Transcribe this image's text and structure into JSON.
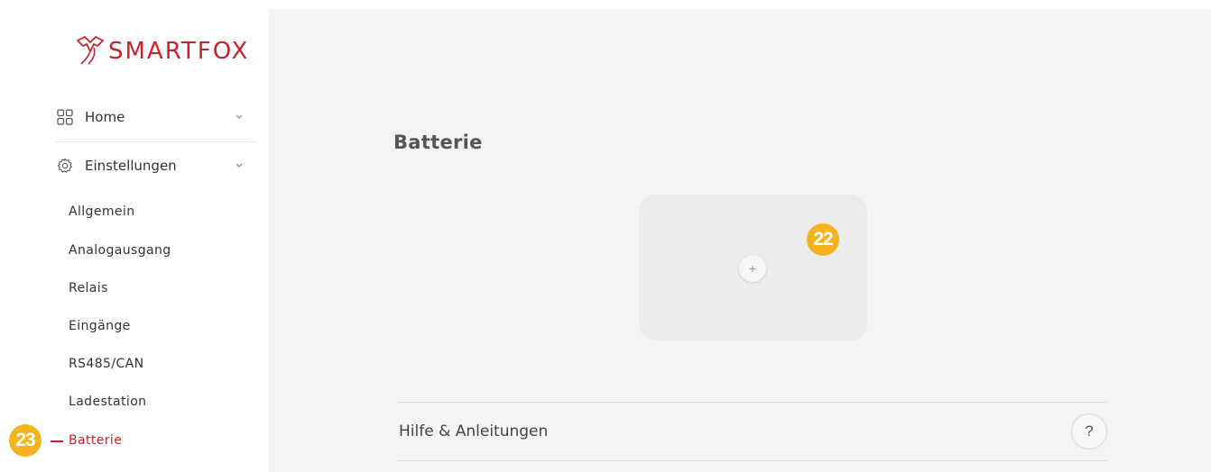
{
  "logo": {
    "text": "SMARTFOX"
  },
  "nav": {
    "home": {
      "label": "Home"
    },
    "settings": {
      "label": "Einstellungen",
      "items": [
        {
          "label": "Allgemein"
        },
        {
          "label": "Analogausgang"
        },
        {
          "label": "Relais"
        },
        {
          "label": "Eingänge"
        },
        {
          "label": "RS485/CAN"
        },
        {
          "label": "Ladestation"
        },
        {
          "label": "Batterie",
          "active": true
        }
      ]
    }
  },
  "annotations": {
    "badge_sidebar": "23",
    "badge_card": "22"
  },
  "main": {
    "title": "Batterie",
    "add_icon": "+",
    "help": {
      "label": "Hilfe & Anleitungen",
      "icon": "?"
    }
  },
  "colors": {
    "brand": "#c8232c",
    "badge": "#f5b320",
    "background": "#f4f4f4"
  }
}
